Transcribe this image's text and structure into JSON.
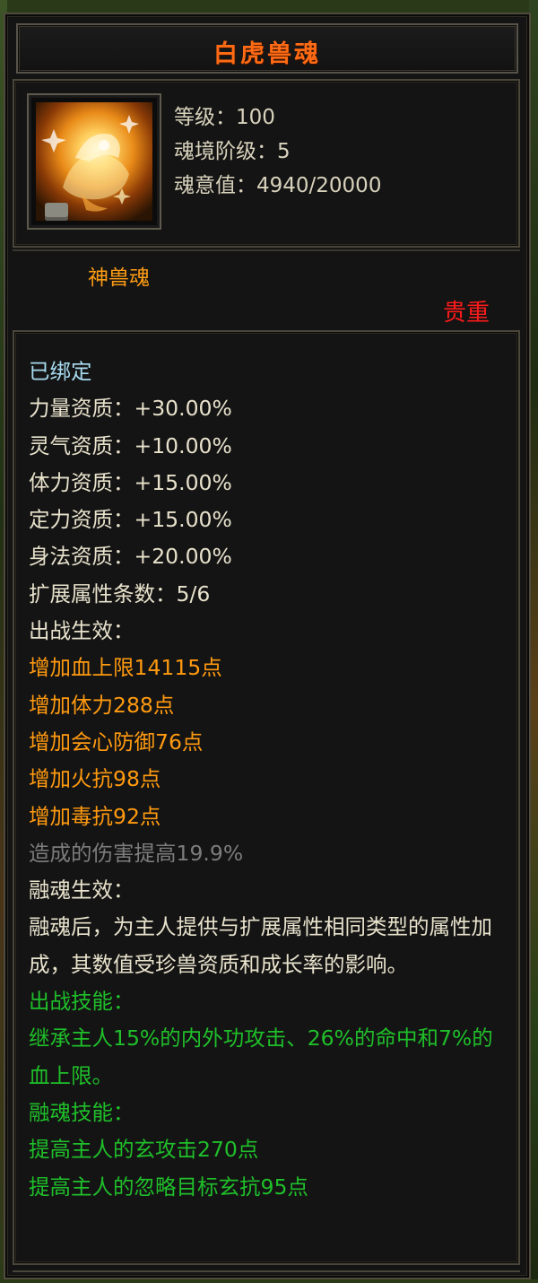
{
  "tooltip": {
    "title": "白虎兽魂",
    "stats": [
      "等级：100",
      "魂境阶级：5",
      "魂意值：4940/20000"
    ],
    "type_label": "神兽魂",
    "rarity": "贵重",
    "bound": "已绑定",
    "aptitudes": [
      "力量资质：+30.00%",
      "灵气资质：+10.00%",
      "体力资质：+15.00%",
      "定力资质：+15.00%",
      "身法资质：+20.00%",
      "扩展属性条数：5/6"
    ],
    "battle_header": "出战生效：",
    "battle_effects": [
      "增加血上限14115点",
      "增加体力288点",
      "增加会心防御76点",
      "增加火抗98点",
      "增加毒抗92点"
    ],
    "damage_line": "造成的伤害提高19.9%",
    "fusion_header": "融魂生效：",
    "fusion_desc": "融魂后，为主人提供与扩展属性相同类型的属性加成，其数值受珍兽资质和成长率的影响。",
    "battle_skill_header": "出战技能：",
    "battle_skill_desc": "继承主人15%的内外功攻击、26%的命中和7%的血上限。",
    "fusion_skill_header": "融魂技能：",
    "fusion_skills": [
      "提高主人的玄攻击270点",
      "提高主人的忽略目标玄抗95点"
    ]
  },
  "colors": {
    "title": "#ff6a14",
    "orange": "#ff9a10",
    "green": "#1fbf2a",
    "rarity": "#ff1a1a",
    "bound": "#a8dcf0",
    "gray": "#7c7c7c"
  },
  "icons": {
    "pet_soul": "white-tiger-soul-icon",
    "lock": "lock-icon"
  }
}
